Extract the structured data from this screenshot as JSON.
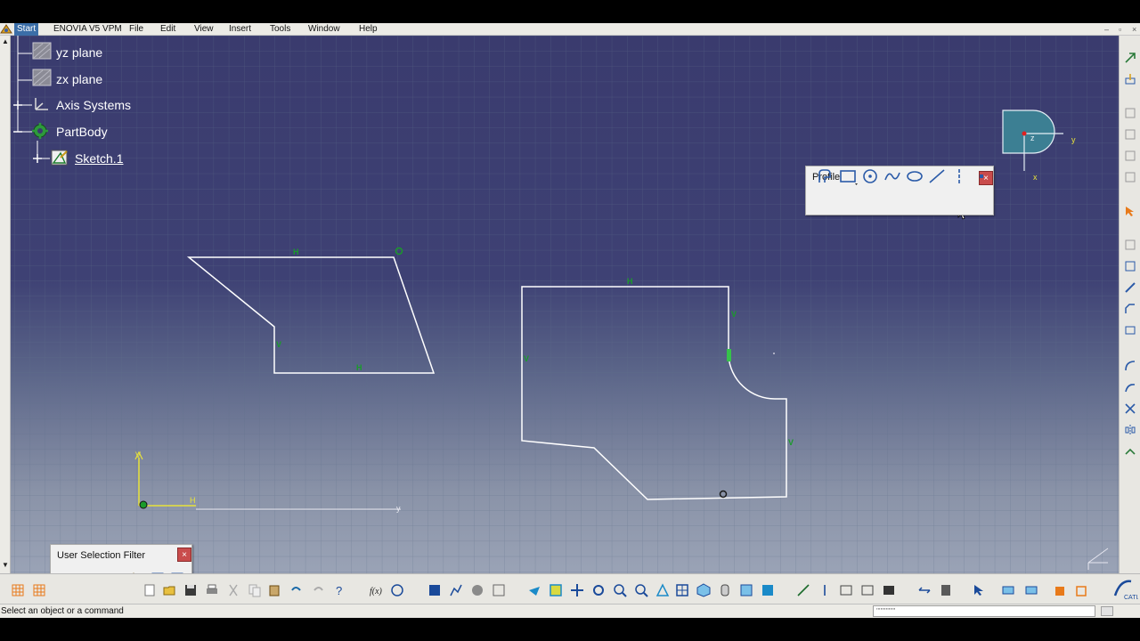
{
  "menubar": {
    "items": [
      "Start",
      "ENOVIA V5 VPM",
      "File",
      "Edit",
      "View",
      "Insert",
      "Tools",
      "Window",
      "Help"
    ]
  },
  "tree": {
    "items": [
      {
        "label": "yz plane",
        "icon": "plane-icon"
      },
      {
        "label": "zx plane",
        "icon": "plane-icon"
      },
      {
        "label": "Axis Systems",
        "icon": "axis-system-icon"
      },
      {
        "label": "PartBody",
        "icon": "part-body-icon"
      },
      {
        "label": "Sketch.1",
        "icon": "sketch-icon"
      }
    ]
  },
  "compass": {
    "z": "z",
    "y": "y",
    "x": "x"
  },
  "sketch": {
    "constraint_h": "H",
    "constraint_v": "V",
    "axis_v": "V",
    "axis_h": "H",
    "axis_y": "y"
  },
  "profile_toolbar": {
    "title": "Profile",
    "close": "×",
    "tools": [
      "profile-icon",
      "rectangle-icon",
      "circle-icon",
      "spline-icon",
      "ellipse-icon",
      "line-icon",
      "axis-icon",
      "point-icon"
    ]
  },
  "usf_toolbar": {
    "title": "User Selection Filter",
    "close": "×"
  },
  "status": {
    "message": "Select an object or a command",
    "command_input": "''''''''''''''"
  },
  "colors": {
    "menu_active": "#3b6ea8",
    "sketch_geometry": "#ffffff",
    "constraint_green": "#1a9b2a",
    "axis_yellow": "#e8e23a",
    "close_red": "#c94c4c"
  }
}
